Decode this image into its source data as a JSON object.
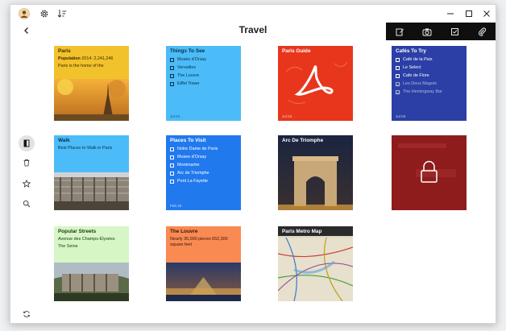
{
  "window": {
    "title": "Travel",
    "controls": {
      "minimize": "—",
      "maximize": "☐",
      "close": "✕"
    }
  },
  "toolbar_icons": [
    "edit-icon",
    "camera-icon",
    "checklist-icon",
    "attach-icon"
  ],
  "sidebar": [
    "notes-icon",
    "trash-icon",
    "star-icon",
    "search-icon"
  ],
  "notes": {
    "paris": {
      "title": "Paris",
      "pop_label": "Population",
      "pop_value": "2014: 2,241,246",
      "text": "Paris is the home of the"
    },
    "things": {
      "title": "Things To See",
      "items": [
        "Musée d'Orsay",
        "Versailles",
        "The Louvre",
        "Eiffel Tower"
      ],
      "date": "Jul 04"
    },
    "guide": {
      "title": "Paris Guide",
      "date": "Jul 04"
    },
    "cafes": {
      "title": "Cafés To Try",
      "items": [
        "Café de la Paix",
        "Le Select",
        "Cafe de Flore",
        "Les Deux Magots",
        "The Hemingway Bar"
      ],
      "checked": [
        false,
        false,
        false,
        true,
        true
      ],
      "date": "Jul 04"
    },
    "walk": {
      "title": "Walk",
      "text": "Best Places to Walk in Paris"
    },
    "places": {
      "title": "Places To Visit",
      "items": [
        "Notre Dame de Paris",
        "Musee d'Orsay",
        "Montmartre",
        "Arc de Triomphe",
        "Pont La Fayette"
      ],
      "date": "Feb 22"
    },
    "arc": {
      "title": "Arc De Triomphe"
    },
    "streets": {
      "title": "Popular Streets",
      "lines": [
        "Avenue des Champs-Élysées",
        "The Seine"
      ]
    },
    "louvre": {
      "title": "The Louvre",
      "text": "Nearly 35,000 pieces 652,300 square feet"
    },
    "metro": {
      "title": "Paris Metro Map"
    }
  },
  "colors": {
    "yellow": "#f2c22c",
    "sky": "#4cbcf8",
    "red": "#e8361c",
    "indigo": "#2b3fa6",
    "blue": "#2179ee",
    "locked": "#8e1c1c",
    "mint": "#d6f6c6",
    "orange": "#f98a52"
  }
}
